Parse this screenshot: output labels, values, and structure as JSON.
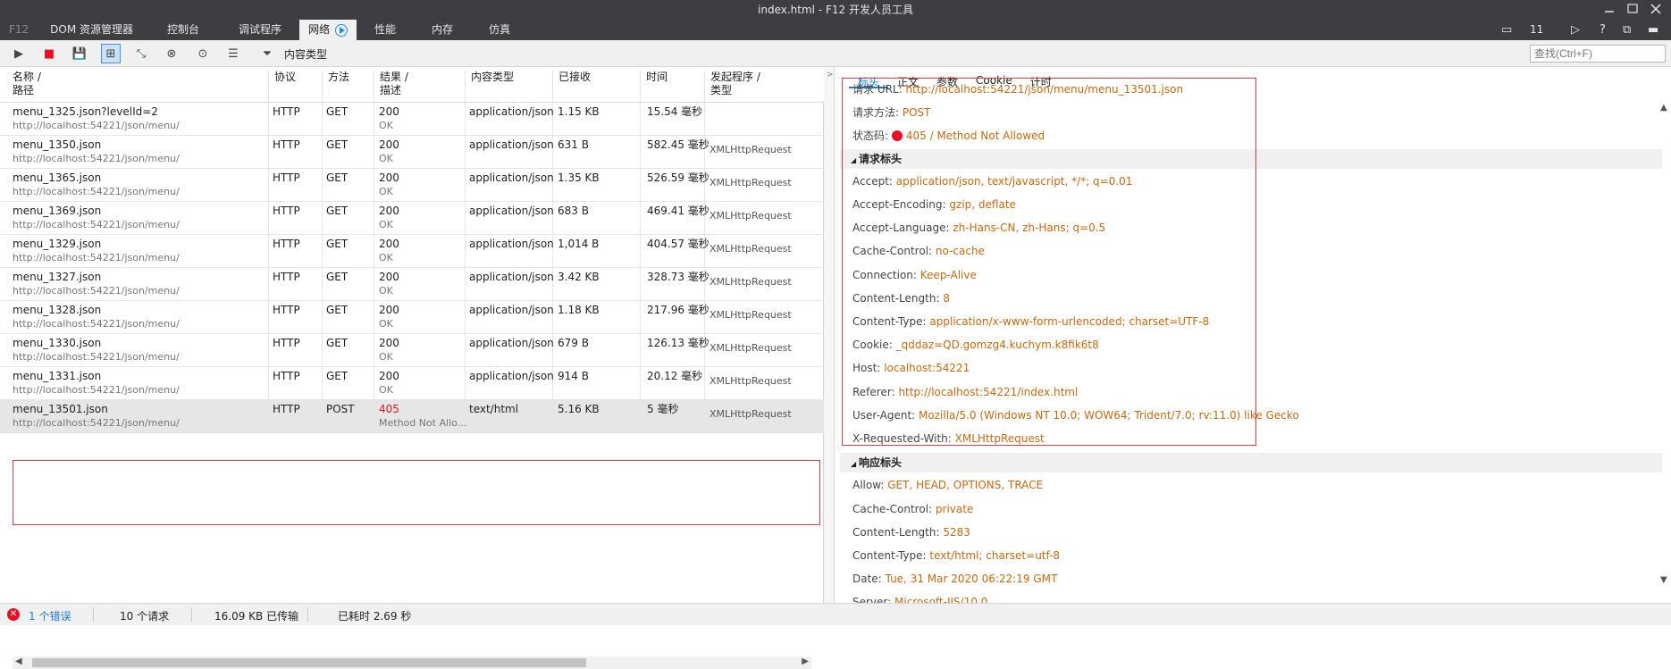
{
  "window": {
    "title": "index.html - F12 开发人员工具",
    "emulation_count": "11"
  },
  "tabs": [
    {
      "label": "F12"
    },
    {
      "label": "DOM 资源管理器"
    },
    {
      "label": "控制台"
    },
    {
      "label": "调试程序"
    },
    {
      "label": "网络"
    },
    {
      "label": "性能"
    },
    {
      "label": "内存"
    },
    {
      "label": "仿真"
    }
  ],
  "toolbar": {
    "filter_label": "内容类型",
    "find_placeholder": "查找(Ctrl+F)"
  },
  "table": {
    "headers": [
      {
        "line1": "名称 /",
        "line2": "路径"
      },
      {
        "line1": "协议",
        "line2": ""
      },
      {
        "line1": "方法",
        "line2": ""
      },
      {
        "line1": "结果 /",
        "line2": "描述"
      },
      {
        "line1": "内容类型",
        "line2": ""
      },
      {
        "line1": "已接收",
        "line2": ""
      },
      {
        "line1": "时间",
        "line2": ""
      },
      {
        "line1": "发起程序 /",
        "line2": "类型"
      }
    ],
    "rows": [
      {
        "name": "menu_1325.json?levelId=2",
        "path": "http://localhost:54221/json/menu/",
        "protocol": "HTTP",
        "method": "GET",
        "result": "200",
        "desc": "OK",
        "type": "application/json",
        "received": "1.15 KB",
        "time": "15.54 毫秒",
        "initiator": ""
      },
      {
        "name": "menu_1350.json",
        "path": "http://localhost:54221/json/menu/",
        "protocol": "HTTP",
        "method": "GET",
        "result": "200",
        "desc": "OK",
        "type": "application/json",
        "received": "631 B",
        "time": "582.45 毫秒",
        "initiator": "XMLHttpRequest"
      },
      {
        "name": "menu_1365.json",
        "path": "http://localhost:54221/json/menu/",
        "protocol": "HTTP",
        "method": "GET",
        "result": "200",
        "desc": "OK",
        "type": "application/json",
        "received": "1.35 KB",
        "time": "526.59 毫秒",
        "initiator": "XMLHttpRequest"
      },
      {
        "name": "menu_1369.json",
        "path": "http://localhost:54221/json/menu/",
        "protocol": "HTTP",
        "method": "GET",
        "result": "200",
        "desc": "OK",
        "type": "application/json",
        "received": "683 B",
        "time": "469.41 毫秒",
        "initiator": "XMLHttpRequest"
      },
      {
        "name": "menu_1329.json",
        "path": "http://localhost:54221/json/menu/",
        "protocol": "HTTP",
        "method": "GET",
        "result": "200",
        "desc": "OK",
        "type": "application/json",
        "received": "1,014 B",
        "time": "404.57 毫秒",
        "initiator": "XMLHttpRequest"
      },
      {
        "name": "menu_1327.json",
        "path": "http://localhost:54221/json/menu/",
        "protocol": "HTTP",
        "method": "GET",
        "result": "200",
        "desc": "OK",
        "type": "application/json",
        "received": "3.42 KB",
        "time": "328.73 毫秒",
        "initiator": "XMLHttpRequest"
      },
      {
        "name": "menu_1328.json",
        "path": "http://localhost:54221/json/menu/",
        "protocol": "HTTP",
        "method": "GET",
        "result": "200",
        "desc": "OK",
        "type": "application/json",
        "received": "1.18 KB",
        "time": "217.96 毫秒",
        "initiator": "XMLHttpRequest"
      },
      {
        "name": "menu_1330.json",
        "path": "http://localhost:54221/json/menu/",
        "protocol": "HTTP",
        "method": "GET",
        "result": "200",
        "desc": "OK",
        "type": "application/json",
        "received": "679 B",
        "time": "126.13 毫秒",
        "initiator": "XMLHttpRequest"
      },
      {
        "name": "menu_1331.json",
        "path": "http://localhost:54221/json/menu/",
        "protocol": "HTTP",
        "method": "GET",
        "result": "200",
        "desc": "OK",
        "type": "application/json",
        "received": "914 B",
        "time": "20.12 毫秒",
        "initiator": "XMLHttpRequest"
      },
      {
        "name": "menu_13501.json",
        "path": "http://localhost:54221/json/menu/",
        "protocol": "HTTP",
        "method": "POST",
        "result": "405",
        "desc": "Method Not Allo...",
        "type": "text/html",
        "received": "5.16 KB",
        "time": "5 毫秒",
        "initiator": "XMLHttpRequest"
      }
    ]
  },
  "details": {
    "tabs": [
      {
        "label": "标头"
      },
      {
        "label": "正文"
      },
      {
        "label": "参数"
      },
      {
        "label": "Cookie"
      },
      {
        "label": "计时"
      }
    ],
    "summary": [
      {
        "key": "请求 URL:",
        "value": "http://localhost:54221/json/menu/menu_13501.json"
      },
      {
        "key": "请求方法:",
        "value": "POST"
      },
      {
        "key": "状态码:",
        "value": "405 / Method Not Allowed"
      }
    ],
    "request_section": "请求标头",
    "request_headers": [
      {
        "key": "Accept:",
        "value": "application/json, text/javascript, */*; q=0.01"
      },
      {
        "key": "Accept-Encoding:",
        "value": "gzip, deflate"
      },
      {
        "key": "Accept-Language:",
        "value": "zh-Hans-CN, zh-Hans; q=0.5"
      },
      {
        "key": "Cache-Control:",
        "value": "no-cache"
      },
      {
        "key": "Connection:",
        "value": "Keep-Alive"
      },
      {
        "key": "Content-Length:",
        "value": "8"
      },
      {
        "key": "Content-Type:",
        "value": "application/x-www-form-urlencoded; charset=UTF-8"
      },
      {
        "key": "Cookie:",
        "value": "_qddaz=QD.gomzg4.kuchym.k8fik6t8"
      },
      {
        "key": "Host:",
        "value": "localhost:54221"
      },
      {
        "key": "Referer:",
        "value": "http://localhost:54221/index.html"
      },
      {
        "key": "User-Agent:",
        "value": "Mozilla/5.0 (Windows NT 10.0; WOW64; Trident/7.0; rv:11.0) like Gecko"
      },
      {
        "key": "X-Requested-With:",
        "value": "XMLHttpRequest"
      }
    ],
    "response_section": "响应标头",
    "response_headers": [
      {
        "key": "Allow:",
        "value": "GET, HEAD, OPTIONS, TRACE"
      },
      {
        "key": "Cache-Control:",
        "value": "private"
      },
      {
        "key": "Content-Length:",
        "value": "5283"
      },
      {
        "key": "Content-Type:",
        "value": "text/html; charset=utf-8"
      },
      {
        "key": "Date:",
        "value": "Tue, 31 Mar 2020 06:22:19 GMT"
      },
      {
        "key": "Server:",
        "value": "Microsoft-IIS/10.0"
      }
    ]
  },
  "statusbar": {
    "errors": "1 个错误",
    "requests": "10 个请求",
    "transferred": "16.09 KB 已传输",
    "elapsed": "已耗时 2.69 秒"
  },
  "colors": {
    "accent": "#1e7ad8",
    "error": "#e81123",
    "value": "#c26a12",
    "highlight_box": "#e0393e"
  }
}
